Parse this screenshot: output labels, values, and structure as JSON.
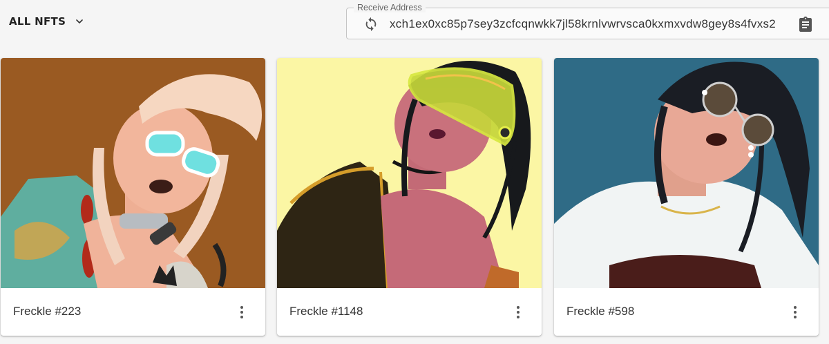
{
  "filter": {
    "label": "ALL NFTS",
    "icon": "chevron-down-icon"
  },
  "receive_address": {
    "legend": "Receive Address",
    "value": "xch1ex0xc85p7sey3zcfcqnwkk7jl58krnlvwrvsca0kxmxvdw8gey8s4fvxs2",
    "refresh_icon": "refresh-icon",
    "copy_icon": "clipboard-icon"
  },
  "nfts": [
    {
      "title": "Freckle #223",
      "bg": "#9a5a22",
      "menu_icon": "more-vert-icon"
    },
    {
      "title": "Freckle #1148",
      "bg": "#fbf6a4",
      "menu_icon": "more-vert-icon"
    },
    {
      "title": "Freckle #598",
      "bg": "#2f6b86",
      "menu_icon": "more-vert-icon"
    }
  ]
}
